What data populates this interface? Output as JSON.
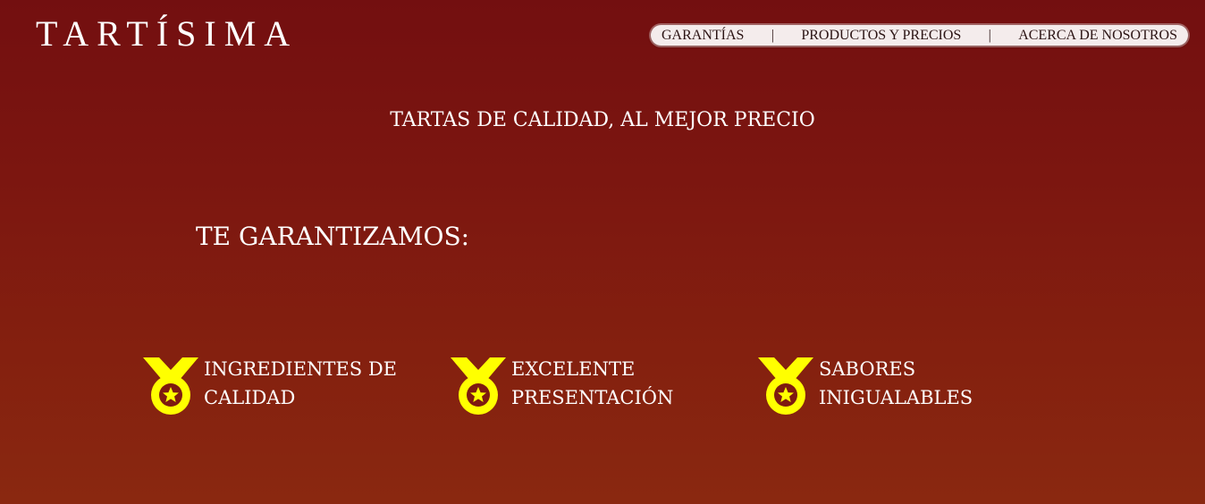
{
  "logo": {
    "text": "TARTÍSIMA"
  },
  "nav": {
    "items": [
      {
        "label": "GARANTÍAS"
      },
      {
        "label": "PRODUCTOS Y PRECIOS"
      },
      {
        "label": "ACERCA DE NOSOTROS"
      }
    ],
    "separator": "|"
  },
  "tagline": "TARTAS DE CALIDAD, AL MEJOR PRECIO",
  "guarantee_heading": "TE GARANTIZAMOS:",
  "features": [
    {
      "icon": "medal-icon",
      "line1": "INGREDIENTES DE",
      "line2": "CALIDAD"
    },
    {
      "icon": "medal-icon",
      "line1": "EXCELENTE",
      "line2": "PRESENTACIÓN"
    },
    {
      "icon": "medal-icon",
      "line1": "SABORES",
      "line2": "INIGUALABLES"
    }
  ],
  "colors": {
    "background_top": "#730f10",
    "background_bottom": "#8a2810",
    "medal": "#ffff00",
    "nav_background": "#f4ecec"
  }
}
